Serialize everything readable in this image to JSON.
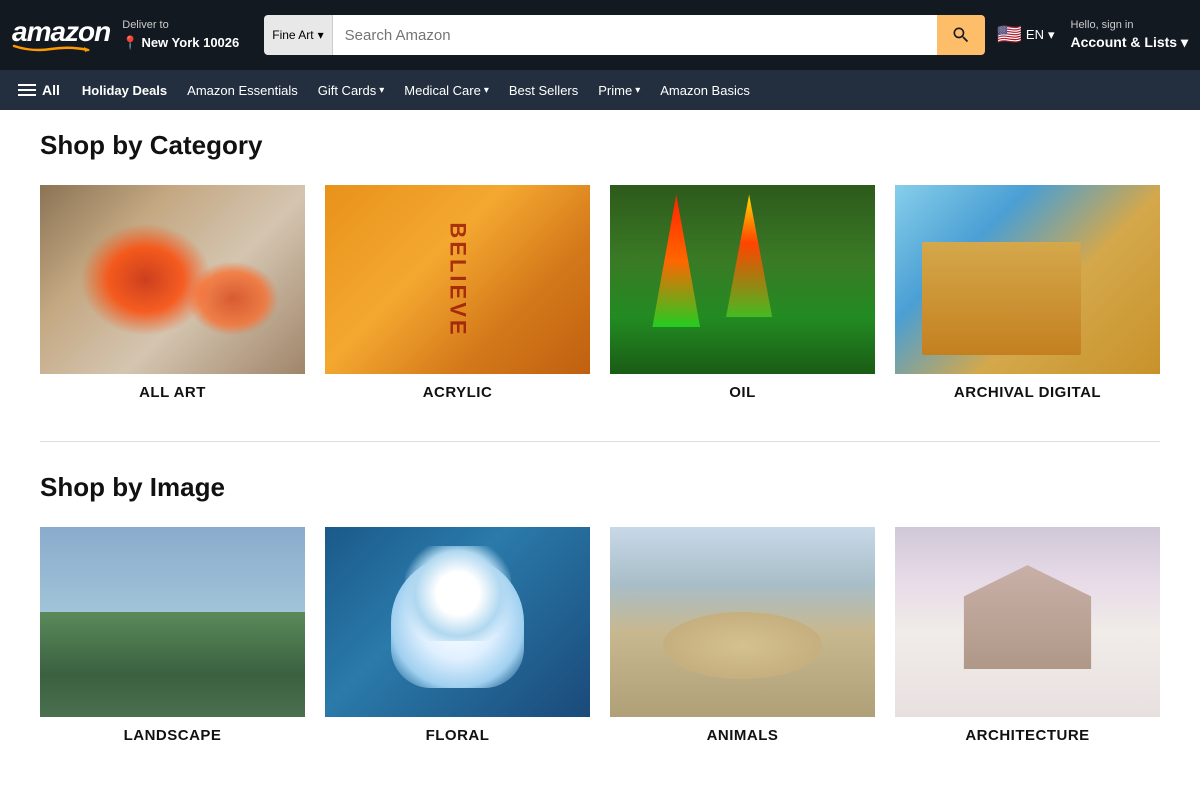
{
  "header": {
    "logo_text": "amazon",
    "deliver_line1": "Deliver to",
    "deliver_line2": "New York 10026",
    "search_category": "Fine Art",
    "search_placeholder": "Search Amazon",
    "search_button_label": "Search",
    "lang": "EN",
    "hello_text": "Hello, sign in",
    "account_text": "Account & Lists"
  },
  "navbar": {
    "all_label": "All",
    "items": [
      {
        "label": "Holiday Deals",
        "bold": true,
        "dropdown": false
      },
      {
        "label": "Amazon Essentials",
        "bold": false,
        "dropdown": false
      },
      {
        "label": "Gift Cards",
        "bold": false,
        "dropdown": true
      },
      {
        "label": "Medical Care",
        "bold": false,
        "dropdown": true
      },
      {
        "label": "Best Sellers",
        "bold": false,
        "dropdown": false
      },
      {
        "label": "Prime",
        "bold": false,
        "dropdown": true
      },
      {
        "label": "Amazon Basics",
        "bold": false,
        "dropdown": false
      }
    ]
  },
  "shop_by_category": {
    "title": "Shop by Category",
    "items": [
      {
        "label": "ALL ART",
        "img_class": "img-all-art"
      },
      {
        "label": "ACRYLIC",
        "img_class": "img-acrylic"
      },
      {
        "label": "OIL",
        "img_class": "img-oil"
      },
      {
        "label": "ARCHIVAL DIGITAL",
        "img_class": "img-archival"
      }
    ]
  },
  "shop_by_image": {
    "title": "Shop by Image",
    "items": [
      {
        "label": "LANDSCAPE",
        "img_class": "img-landscape"
      },
      {
        "label": "FLORAL",
        "img_class": "img-floral"
      },
      {
        "label": "ANIMALS",
        "img_class": "img-animals"
      },
      {
        "label": "ARCHITECTURE",
        "img_class": "img-architecture"
      }
    ]
  }
}
